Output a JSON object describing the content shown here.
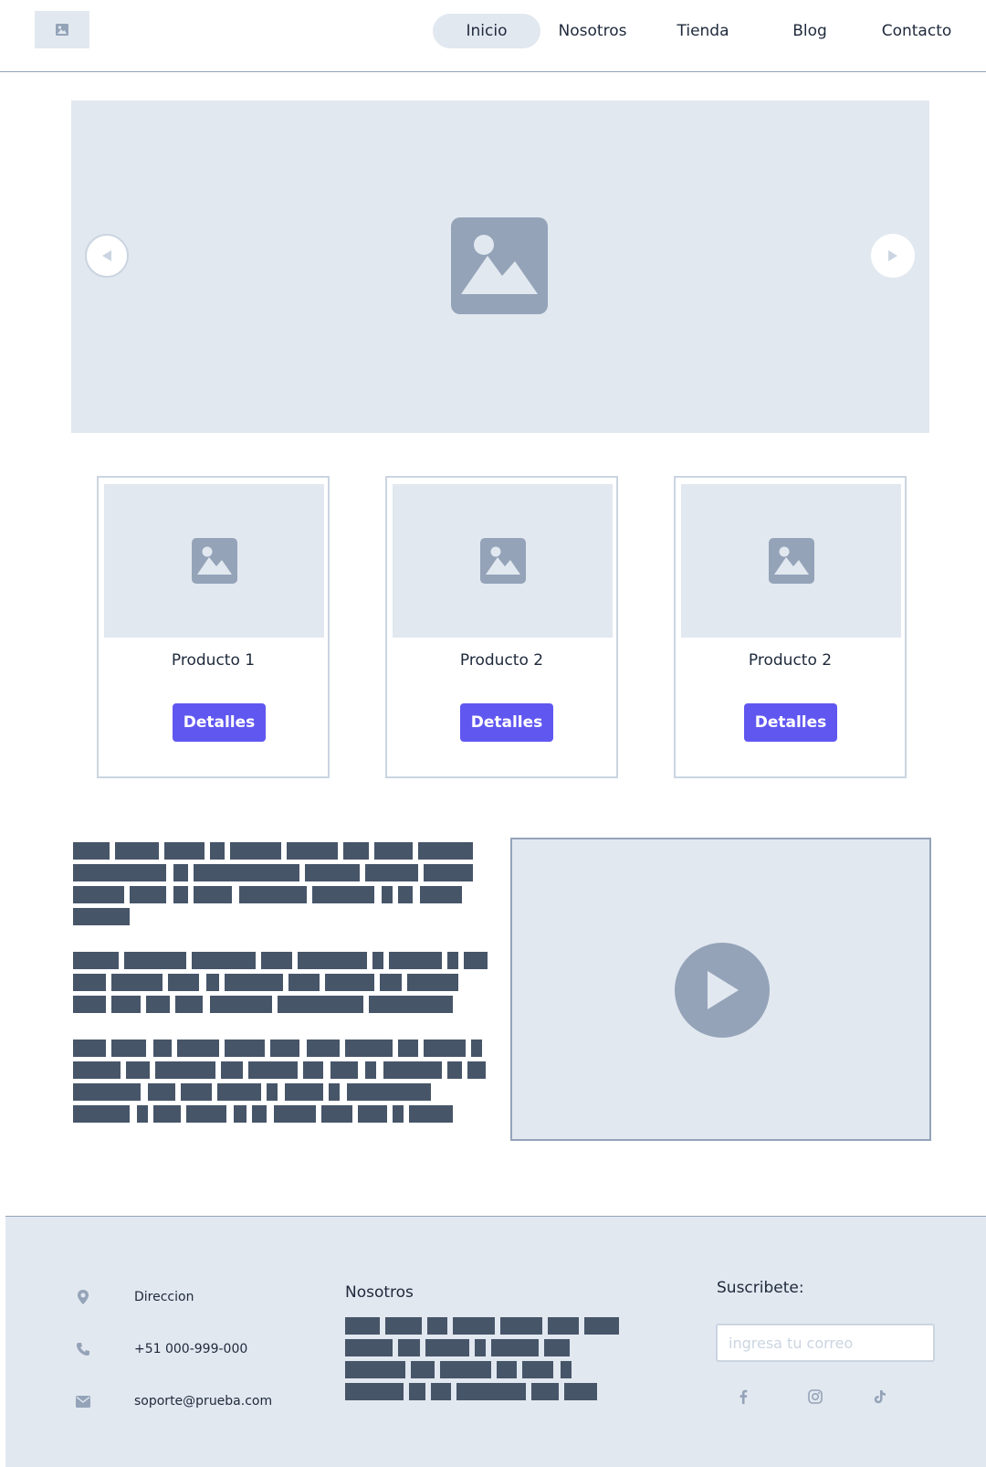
{
  "header": {
    "logo_icon": "image-icon",
    "nav": [
      {
        "label": "Inicio",
        "active": true
      },
      {
        "label": "Nosotros",
        "active": false
      },
      {
        "label": "Tienda",
        "active": false
      },
      {
        "label": "Blog",
        "active": false
      },
      {
        "label": "Contacto",
        "active": false
      }
    ]
  },
  "hero": {
    "image_icon": "image-icon",
    "prev_icon": "triangle-left-icon",
    "next_icon": "triangle-right-icon"
  },
  "products": [
    {
      "title": "Producto 1",
      "button": "Detalles"
    },
    {
      "title": "Producto 2",
      "button": "Detalles"
    },
    {
      "title": "Producto 2",
      "button": "Detalles"
    }
  ],
  "video": {
    "play_icon": "play-icon"
  },
  "footer": {
    "contact": {
      "address": "Direccion",
      "phone": "+51 000-999-000",
      "email": "soporte@prueba.com"
    },
    "about_heading": "Nosotros",
    "subscribe_heading": "Suscribete:",
    "subscribe_placeholder": "ingresa tu correo",
    "social_icons": [
      "facebook-icon",
      "instagram-icon",
      "tiktok-icon"
    ]
  },
  "colors": {
    "accent": "#6057f0",
    "placeholder_bg": "#e2e8f0",
    "text_bar": "#475569",
    "icon_gray": "#94a3b8"
  }
}
